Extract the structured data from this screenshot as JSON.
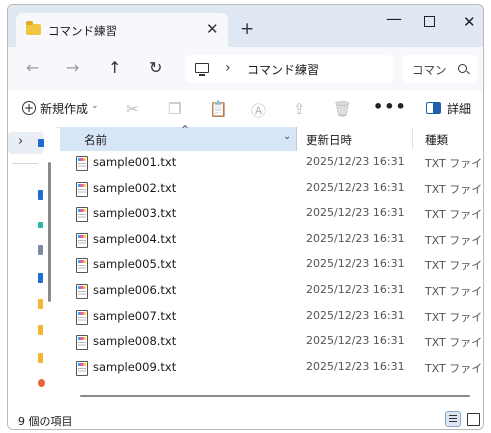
{
  "window": {
    "tab_title": "コマンド練習",
    "tab_close": "✕",
    "new_tab": "+",
    "minimize": "—",
    "close": "✕"
  },
  "nav": {
    "back": "←",
    "forward": "→",
    "up": "↑",
    "refresh": "↻",
    "chevron": "›",
    "address_text": "コマンド練習",
    "search_placeholder": "コマン"
  },
  "commands": {
    "new_label": "新規作成",
    "new_caret": "⌄",
    "more": "•••",
    "details_label": "詳細"
  },
  "columns": {
    "name": "名前",
    "date": "更新日時",
    "type": "種類"
  },
  "files": [
    {
      "name": "sample001.txt",
      "date": "2025/12/23 16:31",
      "type": "TXT ファイル"
    },
    {
      "name": "sample002.txt",
      "date": "2025/12/23 16:31",
      "type": "TXT ファイル"
    },
    {
      "name": "sample003.txt",
      "date": "2025/12/23 16:31",
      "type": "TXT ファイル"
    },
    {
      "name": "sample004.txt",
      "date": "2025/12/23 16:31",
      "type": "TXT ファイル"
    },
    {
      "name": "sample005.txt",
      "date": "2025/12/23 16:31",
      "type": "TXT ファイル"
    },
    {
      "name": "sample006.txt",
      "date": "2025/12/23 16:31",
      "type": "TXT ファイル"
    },
    {
      "name": "sample007.txt",
      "date": "2025/12/23 16:31",
      "type": "TXT ファイル"
    },
    {
      "name": "sample008.txt",
      "date": "2025/12/23 16:31",
      "type": "TXT ファイル"
    },
    {
      "name": "sample009.txt",
      "date": "2025/12/23 16:31",
      "type": "TXT ファイル"
    }
  ],
  "status": {
    "item_count": "9 個の項目"
  },
  "colors": {
    "titlebar": "#dfe8f3",
    "selected_header": "#d6e6f7",
    "accent": "#1f5fae"
  }
}
